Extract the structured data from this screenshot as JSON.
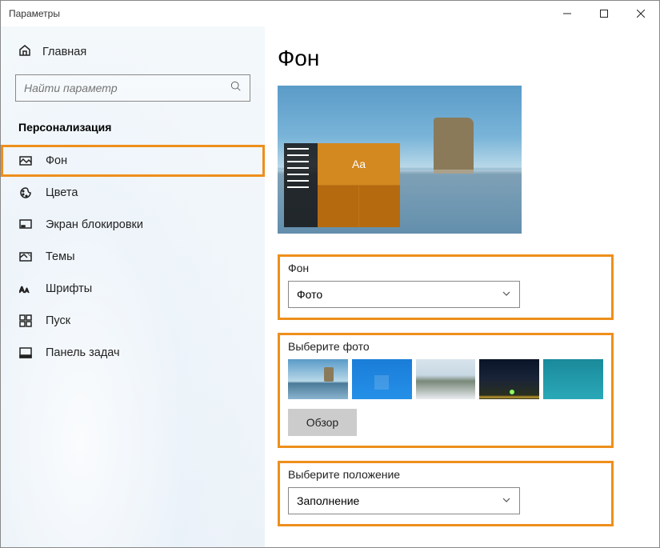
{
  "window": {
    "title": "Параметры"
  },
  "sidebar": {
    "home": "Главная",
    "search_placeholder": "Найти параметр",
    "section": "Персонализация",
    "items": [
      {
        "label": "Фон",
        "icon": "picture-icon",
        "selected": true
      },
      {
        "label": "Цвета",
        "icon": "palette-icon"
      },
      {
        "label": "Экран блокировки",
        "icon": "lockscreen-icon"
      },
      {
        "label": "Темы",
        "icon": "themes-icon"
      },
      {
        "label": "Шрифты",
        "icon": "fonts-icon"
      },
      {
        "label": "Пуск",
        "icon": "start-icon"
      },
      {
        "label": "Панель задач",
        "icon": "taskbar-icon"
      }
    ]
  },
  "main": {
    "title": "Фон",
    "preview_tile_text": "Aa",
    "background_section": {
      "label": "Фон",
      "selected": "Фото"
    },
    "choose_photo": {
      "label": "Выберите фото",
      "browse": "Обзор"
    },
    "fit_section": {
      "label": "Выберите положение",
      "selected": "Заполнение"
    }
  },
  "colors": {
    "highlight": "#ee8f1c"
  }
}
